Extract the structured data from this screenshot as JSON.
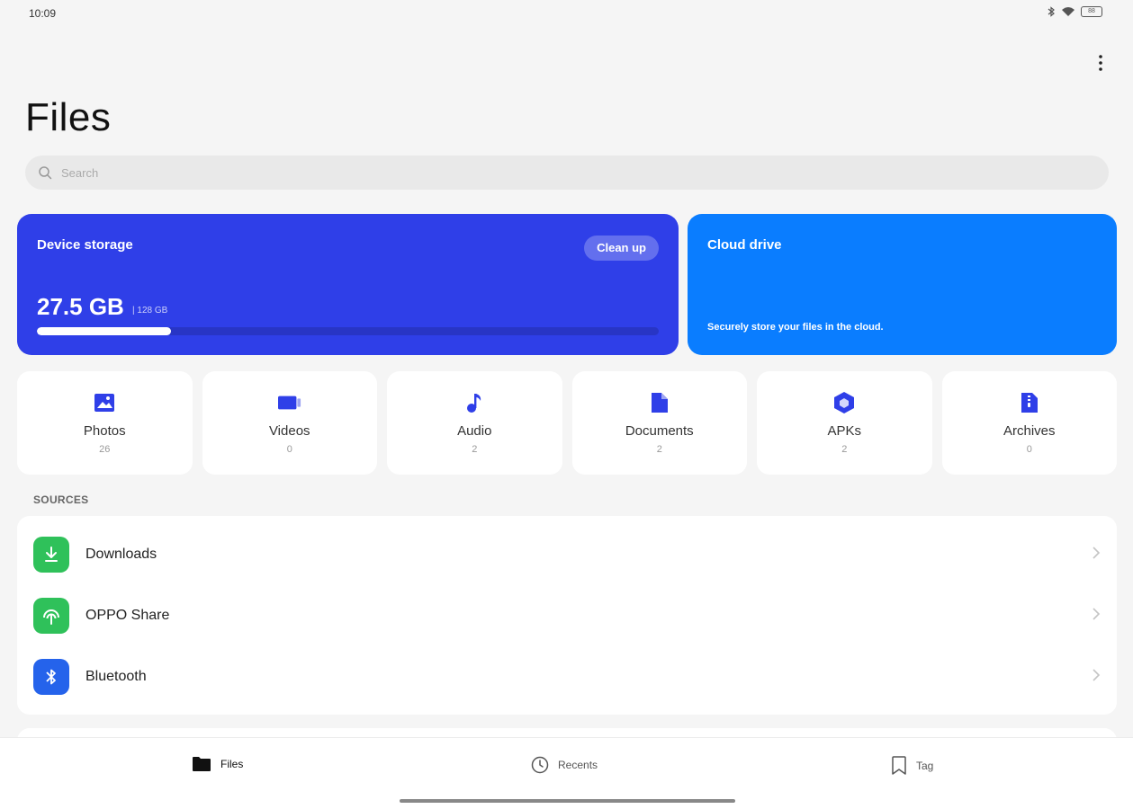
{
  "status_bar": {
    "time": "10:09",
    "battery": "88"
  },
  "header": {
    "title": "Files"
  },
  "search": {
    "placeholder": "Search"
  },
  "device_storage": {
    "title": "Device storage",
    "cleanup_label": "Clean up",
    "used": "27.5 GB",
    "total": "| 128 GB",
    "used_fraction": 0.215
  },
  "cloud_drive": {
    "title": "Cloud drive",
    "description": "Securely store your files in the cloud."
  },
  "categories": [
    {
      "label": "Photos",
      "count": "26",
      "icon": "photo-icon"
    },
    {
      "label": "Videos",
      "count": "0",
      "icon": "video-icon"
    },
    {
      "label": "Audio",
      "count": "2",
      "icon": "music-note-icon"
    },
    {
      "label": "Documents",
      "count": "2",
      "icon": "document-icon"
    },
    {
      "label": "APKs",
      "count": "2",
      "icon": "apk-icon"
    },
    {
      "label": "Archives",
      "count": "0",
      "icon": "archive-icon"
    }
  ],
  "sources": {
    "heading": "SOURCES",
    "items": [
      {
        "label": "Downloads",
        "icon": "download-icon",
        "color": "#2fc15a"
      },
      {
        "label": "OPPO Share",
        "icon": "oppo-share-icon",
        "color": "#2fc15a"
      },
      {
        "label": "Bluetooth",
        "icon": "bluetooth-icon",
        "color": "#2563eb"
      }
    ]
  },
  "bottom_nav": {
    "files": "Files",
    "recents": "Recents",
    "tag": "Tag"
  },
  "colors": {
    "accent": "#2f3fe8",
    "cloud": "#0a7dff",
    "background": "#f5f5f5"
  }
}
